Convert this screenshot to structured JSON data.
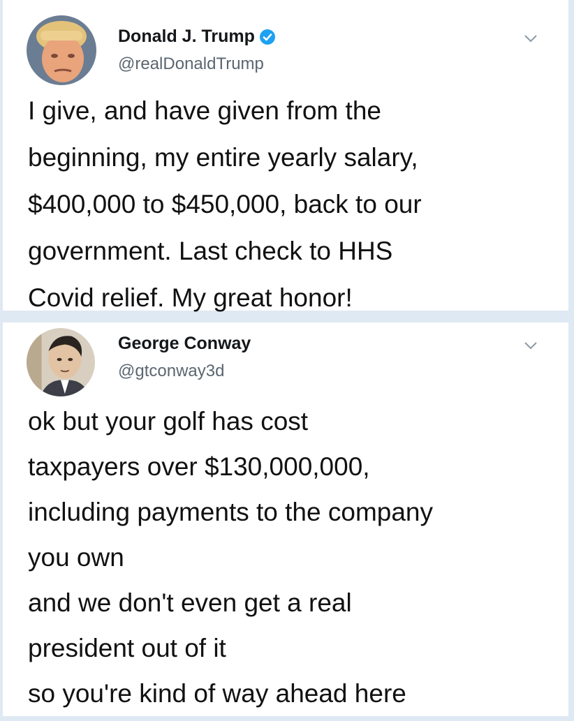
{
  "tweets": [
    {
      "name": "Donald J. Trump",
      "handle": "@realDonaldTrump",
      "verified": true,
      "lines": [
        "I give, and have given from the",
        "beginning, my entire yearly salary,",
        "$400,000 to $450,000, back to our",
        "government. Last check to HHS",
        "Covid relief. My great honor!"
      ]
    },
    {
      "name": "George Conway",
      "handle": "@gtconway3d",
      "verified": false,
      "lines": [
        "ok but your golf has cost",
        "taxpayers over $130,000,000,",
        "including payments to the company",
        "you own",
        "and we don't even get a real",
        "president out of it",
        "so you're kind of way ahead here"
      ]
    }
  ],
  "colors": {
    "background": "#dfe9f4",
    "card": "#ffffff",
    "verified_badge": "#1da1f2",
    "handle_text": "#5b6670"
  },
  "icons": {
    "verified": "verified-badge-icon",
    "menu": "chevron-down-icon"
  }
}
